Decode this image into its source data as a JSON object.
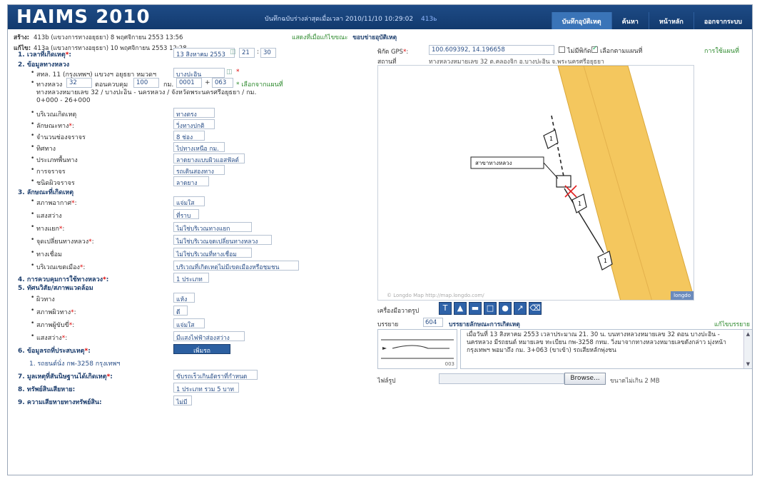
{
  "header": {
    "logo": "HAIMS 2010",
    "status_text": "บันทึกฉบับร่างล่าสุดเมื่อเวลา 2010/11/10 10:29:02",
    "user": "413ь",
    "tabs": [
      {
        "label": "บันทึกอุบัติเหตุ",
        "active": true
      },
      {
        "label": "ค้นหา",
        "active": false
      },
      {
        "label": "หน้าหลัก",
        "active": false
      },
      {
        "label": "ออกจากระบบ",
        "active": false
      }
    ]
  },
  "meta": {
    "created_label": "สร้าง:",
    "created_value": "413b (แขวงการทางอยุธยา)  8 พฤศจิกายน 2553 13:56",
    "edited_label": "แก้ไข:",
    "edited_value": "413a (แขวงการทางอยุธยา)  10 พฤศจิกายน 2553 12:28",
    "history_link": "แสดงที่เมื่อแก้ไขขณะ",
    "section_title": "ขอบข่ายอุบัติเหตุ"
  },
  "form": {
    "s1": {
      "num": "1.",
      "label": "เวลาที่เกิดเหตุ",
      "date": "13 สิงหาคม 2553",
      "hour": "21",
      "minute": "30"
    },
    "s2": {
      "num": "2.",
      "label": "ข้อมูลทางหลวง",
      "district_prefix": "สทล. 11 (กรุงเทพฯ)  แขวงฯ อยุธยา  หมวดฯ",
      "district_value": "บางปะอิน",
      "highway_label": "ทางหลวง",
      "highway_no": "32",
      "control_label": "ตอนควบคุม",
      "control_no": "100",
      "km_label": "กม.",
      "km_a": "0001",
      "km_b": "063",
      "km_note": "* เลือกจากแผนที่",
      "road_desc_1": "ทางหลวงหมายเลข 32 / บางปะอิน - นครหลวง / จังหวัดพระนครศรีอยุธยา / กม.",
      "road_desc_2": "0+000 - 26+000",
      "fields": [
        {
          "label": "บริเวณเกิดเหตุ",
          "value": "ทางตรง",
          "req": false
        },
        {
          "label": "ลักษณะทาง",
          "value": "วิ่งทางปกติ",
          "req": true
        },
        {
          "label": "จำนวนช่องจราจร",
          "value": "8 ช่อง",
          "req": false
        },
        {
          "label": "ทิศทาง",
          "value": "ไปทางเหนือ กม.",
          "req": false
        },
        {
          "label": "ประเภทพื้นทาง",
          "value": "ลาดยางแบบผิวแอสฟัลต์",
          "req": false
        },
        {
          "label": "การจราจร",
          "value": "รถเดินสองทาง",
          "req": false
        },
        {
          "label": "ชนิดผิวจราจร",
          "value": "ลาดยาง",
          "req": false
        }
      ]
    },
    "s3": {
      "num": "3.",
      "label": "ลักษณะที่เกิดเหตุ",
      "fields": [
        {
          "label": "สภาพอากาศ",
          "value": "แจ่มใส",
          "req": true
        },
        {
          "label": "แสงสว่าง",
          "value": "ที่ราบ",
          "req": false
        },
        {
          "label": "ทางแยก",
          "value": "ไม่ใช่บริเวณทางแยก",
          "req": true
        },
        {
          "label": "จุดเปลี่ยนทางหลวง",
          "value": "ไม่ใช่บริเวณจุดเปลี่ยนทางหลวง",
          "req": true
        },
        {
          "label": "ทางเชื่อม",
          "value": "ไม่ใช่บริเวณที่ทางเชื่อม",
          "req": false
        },
        {
          "label": "บริเวณเขตเมือง",
          "value": "บริเวณที่เกิดเหตุไม่มีเขตเมืองหรือชุมชน",
          "req": true
        }
      ]
    },
    "s4": {
      "num": "4.",
      "label": "การควบคุมการใช้ทางหลวง",
      "value": "1 ประเภท",
      "req": true
    },
    "s5": {
      "num": "5.",
      "label": "ทัศนวิสัย/สภาพแวดล้อม",
      "fields": [
        {
          "label": "ผิวทาง",
          "value": "แห้ง",
          "req": false
        },
        {
          "label": "สภาพผิวทาง",
          "value": "ดี",
          "req": true
        },
        {
          "label": "สภาพผู้ขับขี่",
          "value": "แจ่มใส",
          "req": true
        },
        {
          "label": "แสงสว่าง",
          "value": "มีแสงไฟฟ้าส่องสว่าง",
          "req": true
        }
      ]
    },
    "s6": {
      "num": "6.",
      "label": "ข้อมูลรถที่ประสบเหตุ",
      "req": true,
      "button": "เพิ่มรถ",
      "item": "1.  รถยนต์นั่ง  กพ-3258  กรุงเทพฯ"
    },
    "s7": {
      "num": "7.",
      "label": "มูลเหตุที่สันนิษฐานได้เกิดเหตุ",
      "req": true,
      "value": "ขับรถเร็วเกินอัตราที่กำหนด"
    },
    "s8": {
      "num": "8.",
      "label": "ทรัพย์สินเสียหาย",
      "value": "1 ประเภท รวม 5 บาท"
    },
    "s9": {
      "num": "9.",
      "label": "ความเสียหายทางทรัพย์สิน",
      "value": "ไม่มี"
    }
  },
  "map": {
    "gps_label": "พิกัด GPS",
    "gps_value": "100.609392, 14.196658",
    "unknown_label": "ไม่มีพิกัด",
    "unknown_checked": false,
    "auto_label": "เลือกตามแผนที่",
    "auto_checked": true,
    "help_link": "การใช้แผนที่",
    "place_label": "สถานที่",
    "place_value": "ทางหลวงหมายเลข 32 ต.คลองจิก อ.บางปะอิน จ.พระนครศรีอยุธยา",
    "callout": "สาขาทางหลวง",
    "markers": [
      "1",
      "1",
      "1"
    ],
    "credit": "© Longdo Map  http://map.longdo.com/",
    "brand": "longdo"
  },
  "drawing": {
    "label": "เครื่องมือวาดรูป",
    "tools": [
      {
        "name": "text-tool-icon",
        "glyph": "T"
      },
      {
        "name": "triangle-tool-icon",
        "glyph": "▲"
      },
      {
        "name": "line-tool-icon",
        "glyph": "▬"
      },
      {
        "name": "rectangle-tool-icon",
        "glyph": "□"
      },
      {
        "name": "circle-tool-icon",
        "glyph": "●"
      },
      {
        "name": "arrow-tool-icon",
        "glyph": "↗"
      },
      {
        "name": "erase-tool-icon",
        "glyph": "⌫"
      }
    ]
  },
  "description": {
    "label": "บรรยาย",
    "count": "604",
    "heading": "บรรยายลักษณะการเกิดเหตุ",
    "edit_link": "แก้ไขบรรยาย",
    "thumb_number": "003",
    "text": "เมื่อวันที่ 13 สิงหาคม 2553 เวลาประมาณ 21. 30 น. บนทางหลวงหมายเลข 32 ตอน บางปะอิน - นครหลวง มีรถยนต์ หมายเลข ทะเบียน กพ-3258 กทม. วิ่งมาจากทางหลวงหมายเลขดังกล่าว มุ่งหน้ากรุงเทพฯ พอมาถึง กม. 3+063 (ขาเข้า) รถเสียหลักพุ่งชน"
  },
  "attachment": {
    "label": "ไฟล์รูป",
    "browse": "Browse...",
    "max_size": "ขนาดไม่เกิน 2 MB"
  }
}
